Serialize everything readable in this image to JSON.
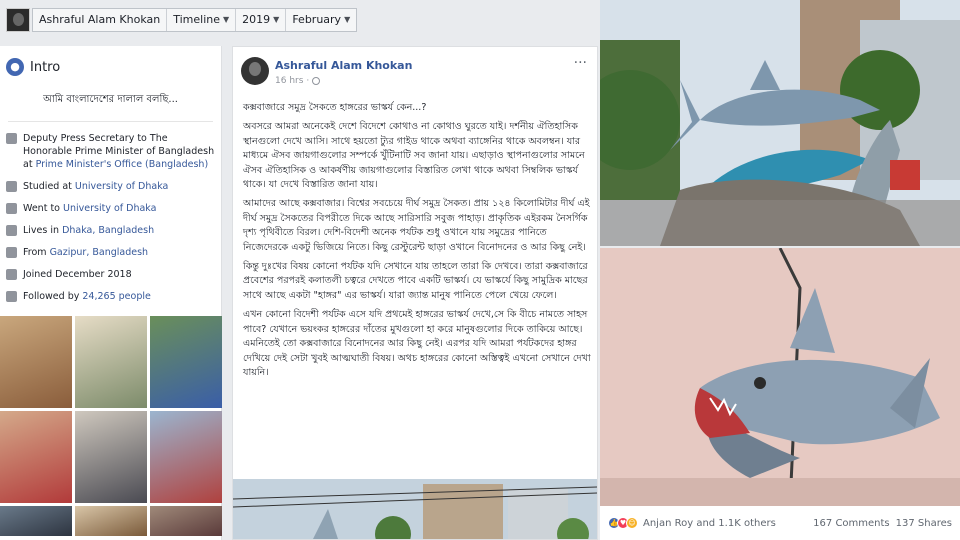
{
  "topbar": {
    "name": "Ashraful Alam Khokan",
    "timeline": "Timeline",
    "year": "2019",
    "month": "February"
  },
  "intro": {
    "title": "Intro",
    "bio": "আমি বাংলাদেশের দালাল বলছি...",
    "items": [
      {
        "icon": "briefcase-icon",
        "text": "Deputy Press Secretary to The Honorable Prime Minister of Bangladesh at ",
        "link": "Prime Minister's Office (Bangladesh)"
      },
      {
        "icon": "graduation-cap-icon",
        "text": "Studied at ",
        "link": "University of Dhaka"
      },
      {
        "icon": "graduation-cap-icon",
        "text": "Went to ",
        "link": "University of Dhaka"
      },
      {
        "icon": "home-icon",
        "text": "Lives in ",
        "link": "Dhaka, Bangladesh"
      },
      {
        "icon": "location-pin-icon",
        "text": "From ",
        "link": "Gazipur, Bangladesh"
      },
      {
        "icon": "clock-icon",
        "text": "Joined December 2018",
        "link": ""
      },
      {
        "icon": "rss-icon",
        "text": "Followed by ",
        "link": "24,265 people"
      }
    ]
  },
  "post": {
    "author": "Ashraful Alam Khokan",
    "time": "16 hrs",
    "paragraphs": [
      "কক্সবাজারে সমুদ্র সৈকতে হাঙ্গরের ভাস্কর্য কেন...?",
      "অবসরে আমরা অনেকেই দেশে বিদেশে কোথাও না কোথাও ঘুরতে যাই। দর্শনীয় ঐতিহাসিক স্থানগুলো দেখে আসি। সাথে হয়তো ট্যুর গাইড থাকে অথবা ব্যাঙ্গেনির থাকে অবলম্বন। যার মাধ্যমে ঐসব জায়গাগুলোর সম্পর্কে খুঁটিনাটি সব জানা যায়। এছাড়াও স্থাপনাগুলোর সামনে ঐসব ঐতিহাসিক ও আকর্ষণীয় জায়গাগুলোর বিস্তারিত লেখা থাকে অথবা সিম্বলিক ভাস্কর্য থাকে। যা দেখে বিস্তারিত জানা যায়।",
      "আমাদের আছে কক্সবাজার। বিশ্বের সবচেয়ে দীর্ঘ সমুদ্র সৈকত। প্রায় ১২৪ কিলোমিটার দীর্ঘ এই দীর্ঘ সমুদ্র সৈকতের বিপরীতে দিকে আছে সারিসারি সবুজ পাহাড়। প্রাকৃতিক এইরকম নৈসর্গিক দৃশ্য পৃথিবীতে বিরল। দেশি-বিদেশী অনেক পর্যটক শুধু ওখানে যায় সমুদ্রের পানিতে নিজেদেরকে একটু ভিজিয়ে নিতে। কিছু রেস্টুরেন্ট ছাড়া ওখানে বিনোদনের ও আর কিছু নেই।",
      "কিন্তু দুঃখের বিষয় কোনো পর্যটক যদি সেখানে যায় তাহলে তারা কি দেখবে। তারা কক্সবাজারে প্রবেশের পরপরই কলাতলী চত্বরে দেখতে পাবে একটি ভাস্কর্য। যে ভাস্কর্যে কিছু সামুদ্রিক মাছের সাথে আছে একটা \"হাঙ্গর\" এর ভাস্কর্য। যারা জ্যান্ত মানুষ পানিতে পেলে খেয়ে ফেলে।",
      "এখন কোনো বিদেশী পর্যটক এসে যদি প্রথমেই হাঙ্গরের ভাস্কর্য দেখে,সে কি বীচে নামতে সাহস পাবে? যেখানে ভয়ংকর হাঙ্গরের দাঁতের মুখগুলো হা করে মানুষগুলোর দিকে তাকিয়ে আছে। এমনিতেই তো কক্সবাজারে বিনোদনের আর কিছু নেই। এরপর যদি আমরা পর্যটকদের হাঙ্গর দেখিয়ে দেই সেটা খুবই আত্মঘাতী বিষয়। অথচ হাঙ্গরের কোনো অস্তিত্বই এখনো সেখানে দেখা যায়নি।"
    ]
  },
  "reactions": {
    "icons": [
      "like-icon",
      "love-icon",
      "haha-icon"
    ],
    "who": "Anjan Roy and 1.1K others",
    "comments": "167 Comments",
    "shares": "137 Shares"
  },
  "colors": {
    "link": "#365899",
    "brand": "#4267b2",
    "background": "#e9ebee"
  }
}
